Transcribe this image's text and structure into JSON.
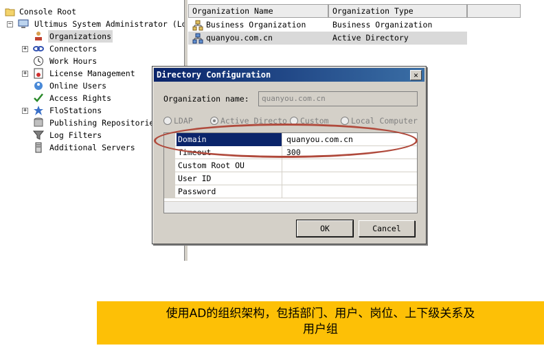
{
  "tree": {
    "nodes": [
      {
        "label": "Console Root"
      },
      {
        "label": "Ultimus System Administrator (Lo"
      },
      {
        "label": "Organizations"
      },
      {
        "label": "Connectors"
      },
      {
        "label": "Work Hours"
      },
      {
        "label": "License Management"
      },
      {
        "label": "Online Users"
      },
      {
        "label": "Access Rights"
      },
      {
        "label": "FloStations"
      },
      {
        "label": "Publishing Repositorie"
      },
      {
        "label": "Log Filters"
      },
      {
        "label": "Additional Servers"
      }
    ],
    "expander_collapsed": "+",
    "expander_expanded": "−"
  },
  "list": {
    "columns": [
      "Organization Name",
      "Organization Type"
    ],
    "rows": [
      {
        "name": "Business Organization",
        "type": "Business Organization"
      },
      {
        "name": "quanyou.com.cn",
        "type": "Active Directory"
      }
    ]
  },
  "dialog": {
    "title": "Directory Configuration",
    "close_glyph": "✕",
    "org_name_label": "Organization name:",
    "org_name_value": "quanyou.com.cn",
    "radios": [
      {
        "label": "LDAP",
        "checked": false
      },
      {
        "label": "Active Directo",
        "checked": true
      },
      {
        "label": "Custom",
        "checked": false
      },
      {
        "label": "Local Computer",
        "checked": false
      }
    ],
    "properties": [
      {
        "key": "Domain",
        "value": "quanyou.com.cn"
      },
      {
        "key": "Timeout",
        "value": "300"
      },
      {
        "key": "Custom Root OU",
        "value": ""
      },
      {
        "key": "User ID",
        "value": ""
      },
      {
        "key": "Password",
        "value": ""
      }
    ],
    "ok_label": "OK",
    "cancel_label": "Cancel"
  },
  "caption": {
    "line1": "使用AD的组织架构，包括部门、用户、岗位、上下级关系及",
    "line2": "用户组"
  },
  "colors": {
    "titlebar": "#0a246a",
    "selection": "#0a246a",
    "annotation": "#b04a3c",
    "caption_bg": "#fdc006"
  }
}
